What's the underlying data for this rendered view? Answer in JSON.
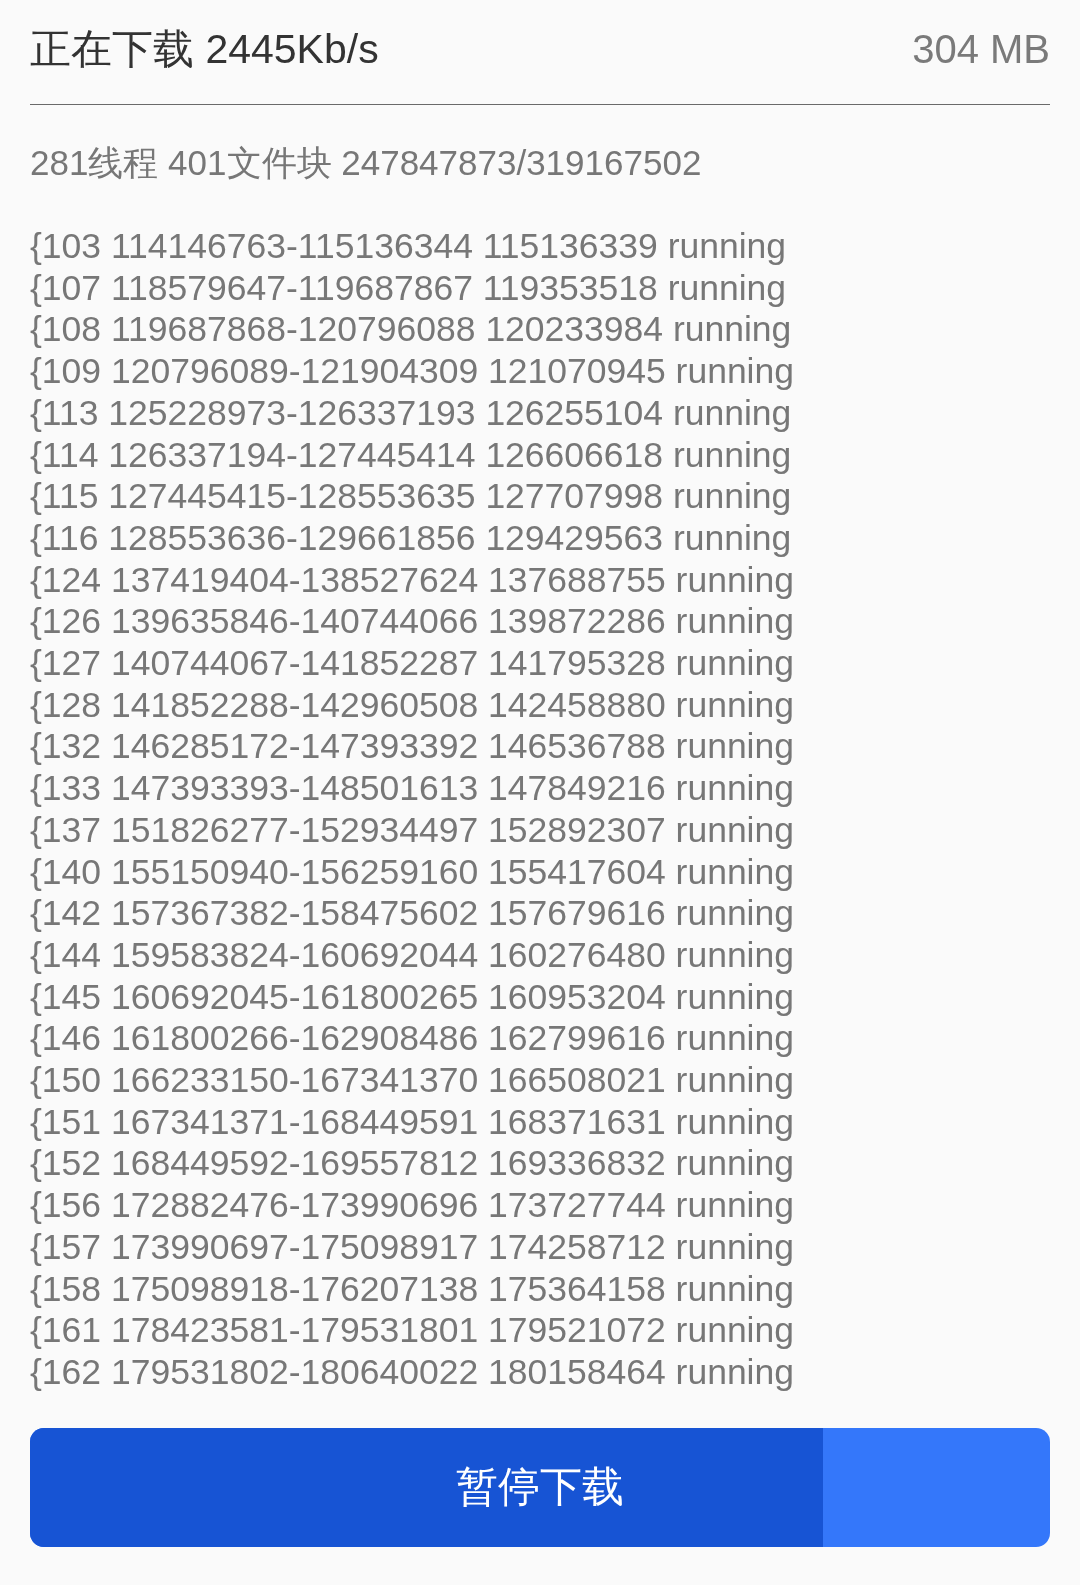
{
  "header": {
    "speed": "正在下载 2445Kb/s",
    "size": "304 MB"
  },
  "summary": "281线程 401文件块 247847873/319167502",
  "threads": [
    "{103 114146763-115136344 115136339 running",
    "{107 118579647-119687867 119353518 running",
    "{108 119687868-120796088 120233984 running",
    "{109 120796089-121904309 121070945 running",
    "{113 125228973-126337193 126255104 running",
    "{114 126337194-127445414 126606618 running",
    "{115 127445415-128553635 127707998 running",
    "{116 128553636-129661856 129429563 running",
    "{124 137419404-138527624 137688755 running",
    "{126 139635846-140744066 139872286 running",
    "{127 140744067-141852287 141795328 running",
    "{128 141852288-142960508 142458880 running",
    "{132 146285172-147393392 146536788 running",
    "{133 147393393-148501613 147849216 running",
    "{137 151826277-152934497 152892307 running",
    "{140 155150940-156259160 155417604 running",
    "{142 157367382-158475602 157679616 running",
    "{144 159583824-160692044 160276480 running",
    "{145 160692045-161800265 160953204 running",
    "{146 161800266-162908486 162799616 running",
    "{150 166233150-167341370 166508021 running",
    "{151 167341371-168449591 168371631 running",
    "{152 168449592-169557812 169336832 running",
    "{156 172882476-173990696 173727744 running",
    "{157 173990697-175098917 174258712 running",
    "{158 175098918-176207138 175364158 running",
    "{161 178423581-179531801 179521072 running",
    "{162 179531802-180640022 180158464 running"
  ],
  "button": {
    "label": "暂停下载",
    "level": 0.777
  }
}
